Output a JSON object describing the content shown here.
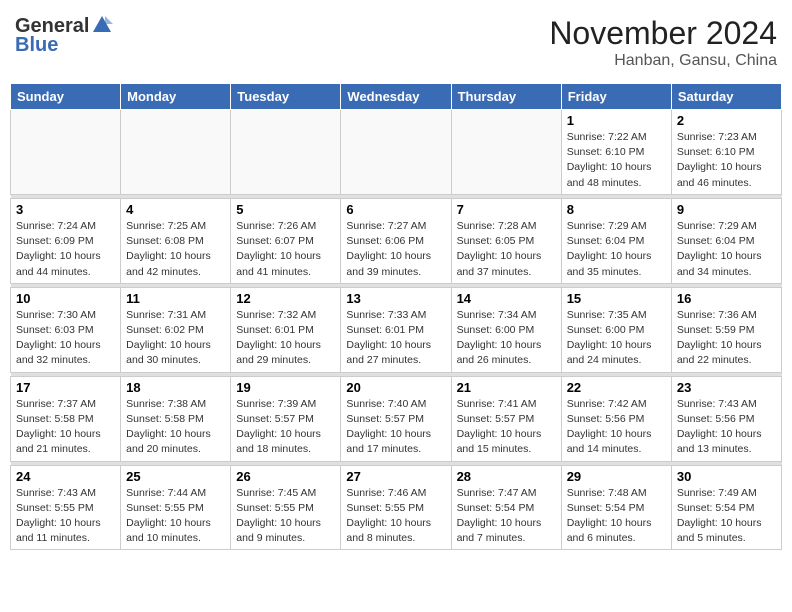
{
  "header": {
    "logo_general": "General",
    "logo_blue": "Blue",
    "month_title": "November 2024",
    "location": "Hanban, Gansu, China"
  },
  "weekdays": [
    "Sunday",
    "Monday",
    "Tuesday",
    "Wednesday",
    "Thursday",
    "Friday",
    "Saturday"
  ],
  "weeks": [
    [
      {
        "day": "",
        "sunrise": "",
        "sunset": "",
        "daylight": ""
      },
      {
        "day": "",
        "sunrise": "",
        "sunset": "",
        "daylight": ""
      },
      {
        "day": "",
        "sunrise": "",
        "sunset": "",
        "daylight": ""
      },
      {
        "day": "",
        "sunrise": "",
        "sunset": "",
        "daylight": ""
      },
      {
        "day": "",
        "sunrise": "",
        "sunset": "",
        "daylight": ""
      },
      {
        "day": "1",
        "sunrise": "Sunrise: 7:22 AM",
        "sunset": "Sunset: 6:10 PM",
        "daylight": "Daylight: 10 hours and 48 minutes."
      },
      {
        "day": "2",
        "sunrise": "Sunrise: 7:23 AM",
        "sunset": "Sunset: 6:10 PM",
        "daylight": "Daylight: 10 hours and 46 minutes."
      }
    ],
    [
      {
        "day": "3",
        "sunrise": "Sunrise: 7:24 AM",
        "sunset": "Sunset: 6:09 PM",
        "daylight": "Daylight: 10 hours and 44 minutes."
      },
      {
        "day": "4",
        "sunrise": "Sunrise: 7:25 AM",
        "sunset": "Sunset: 6:08 PM",
        "daylight": "Daylight: 10 hours and 42 minutes."
      },
      {
        "day": "5",
        "sunrise": "Sunrise: 7:26 AM",
        "sunset": "Sunset: 6:07 PM",
        "daylight": "Daylight: 10 hours and 41 minutes."
      },
      {
        "day": "6",
        "sunrise": "Sunrise: 7:27 AM",
        "sunset": "Sunset: 6:06 PM",
        "daylight": "Daylight: 10 hours and 39 minutes."
      },
      {
        "day": "7",
        "sunrise": "Sunrise: 7:28 AM",
        "sunset": "Sunset: 6:05 PM",
        "daylight": "Daylight: 10 hours and 37 minutes."
      },
      {
        "day": "8",
        "sunrise": "Sunrise: 7:29 AM",
        "sunset": "Sunset: 6:04 PM",
        "daylight": "Daylight: 10 hours and 35 minutes."
      },
      {
        "day": "9",
        "sunrise": "Sunrise: 7:29 AM",
        "sunset": "Sunset: 6:04 PM",
        "daylight": "Daylight: 10 hours and 34 minutes."
      }
    ],
    [
      {
        "day": "10",
        "sunrise": "Sunrise: 7:30 AM",
        "sunset": "Sunset: 6:03 PM",
        "daylight": "Daylight: 10 hours and 32 minutes."
      },
      {
        "day": "11",
        "sunrise": "Sunrise: 7:31 AM",
        "sunset": "Sunset: 6:02 PM",
        "daylight": "Daylight: 10 hours and 30 minutes."
      },
      {
        "day": "12",
        "sunrise": "Sunrise: 7:32 AM",
        "sunset": "Sunset: 6:01 PM",
        "daylight": "Daylight: 10 hours and 29 minutes."
      },
      {
        "day": "13",
        "sunrise": "Sunrise: 7:33 AM",
        "sunset": "Sunset: 6:01 PM",
        "daylight": "Daylight: 10 hours and 27 minutes."
      },
      {
        "day": "14",
        "sunrise": "Sunrise: 7:34 AM",
        "sunset": "Sunset: 6:00 PM",
        "daylight": "Daylight: 10 hours and 26 minutes."
      },
      {
        "day": "15",
        "sunrise": "Sunrise: 7:35 AM",
        "sunset": "Sunset: 6:00 PM",
        "daylight": "Daylight: 10 hours and 24 minutes."
      },
      {
        "day": "16",
        "sunrise": "Sunrise: 7:36 AM",
        "sunset": "Sunset: 5:59 PM",
        "daylight": "Daylight: 10 hours and 22 minutes."
      }
    ],
    [
      {
        "day": "17",
        "sunrise": "Sunrise: 7:37 AM",
        "sunset": "Sunset: 5:58 PM",
        "daylight": "Daylight: 10 hours and 21 minutes."
      },
      {
        "day": "18",
        "sunrise": "Sunrise: 7:38 AM",
        "sunset": "Sunset: 5:58 PM",
        "daylight": "Daylight: 10 hours and 20 minutes."
      },
      {
        "day": "19",
        "sunrise": "Sunrise: 7:39 AM",
        "sunset": "Sunset: 5:57 PM",
        "daylight": "Daylight: 10 hours and 18 minutes."
      },
      {
        "day": "20",
        "sunrise": "Sunrise: 7:40 AM",
        "sunset": "Sunset: 5:57 PM",
        "daylight": "Daylight: 10 hours and 17 minutes."
      },
      {
        "day": "21",
        "sunrise": "Sunrise: 7:41 AM",
        "sunset": "Sunset: 5:57 PM",
        "daylight": "Daylight: 10 hours and 15 minutes."
      },
      {
        "day": "22",
        "sunrise": "Sunrise: 7:42 AM",
        "sunset": "Sunset: 5:56 PM",
        "daylight": "Daylight: 10 hours and 14 minutes."
      },
      {
        "day": "23",
        "sunrise": "Sunrise: 7:43 AM",
        "sunset": "Sunset: 5:56 PM",
        "daylight": "Daylight: 10 hours and 13 minutes."
      }
    ],
    [
      {
        "day": "24",
        "sunrise": "Sunrise: 7:43 AM",
        "sunset": "Sunset: 5:55 PM",
        "daylight": "Daylight: 10 hours and 11 minutes."
      },
      {
        "day": "25",
        "sunrise": "Sunrise: 7:44 AM",
        "sunset": "Sunset: 5:55 PM",
        "daylight": "Daylight: 10 hours and 10 minutes."
      },
      {
        "day": "26",
        "sunrise": "Sunrise: 7:45 AM",
        "sunset": "Sunset: 5:55 PM",
        "daylight": "Daylight: 10 hours and 9 minutes."
      },
      {
        "day": "27",
        "sunrise": "Sunrise: 7:46 AM",
        "sunset": "Sunset: 5:55 PM",
        "daylight": "Daylight: 10 hours and 8 minutes."
      },
      {
        "day": "28",
        "sunrise": "Sunrise: 7:47 AM",
        "sunset": "Sunset: 5:54 PM",
        "daylight": "Daylight: 10 hours and 7 minutes."
      },
      {
        "day": "29",
        "sunrise": "Sunrise: 7:48 AM",
        "sunset": "Sunset: 5:54 PM",
        "daylight": "Daylight: 10 hours and 6 minutes."
      },
      {
        "day": "30",
        "sunrise": "Sunrise: 7:49 AM",
        "sunset": "Sunset: 5:54 PM",
        "daylight": "Daylight: 10 hours and 5 minutes."
      }
    ]
  ]
}
